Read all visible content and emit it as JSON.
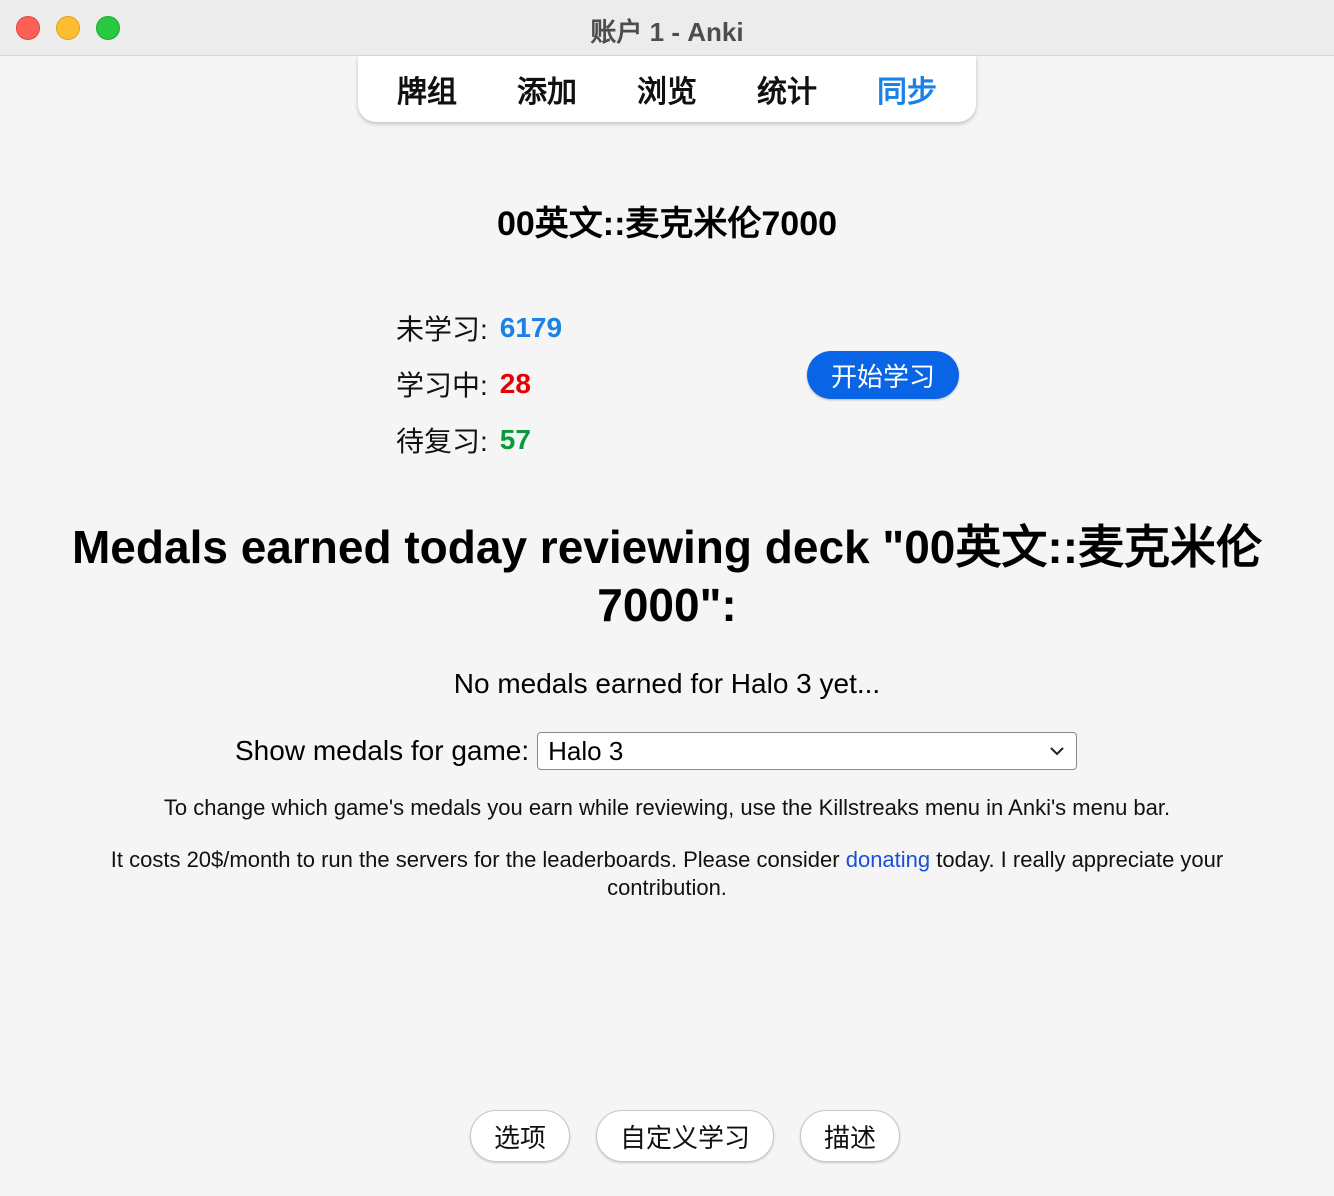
{
  "window": {
    "title": "账户 1 - Anki"
  },
  "toolbar": {
    "items": [
      {
        "label": "牌组",
        "active": false
      },
      {
        "label": "添加",
        "active": false
      },
      {
        "label": "浏览",
        "active": false
      },
      {
        "label": "统计",
        "active": false
      },
      {
        "label": "同步",
        "active": true
      }
    ],
    "active_color": "#1a82e6"
  },
  "deck": {
    "title": "00英文::麦克米伦7000",
    "stats": [
      {
        "label": "未学习:",
        "value": "6179",
        "color": "#1a82e6"
      },
      {
        "label": "学习中:",
        "value": "28",
        "color": "#e60000"
      },
      {
        "label": "待复习:",
        "value": "57",
        "color": "#0a9a3c"
      }
    ],
    "study_button": "开始学习"
  },
  "medals": {
    "heading": "Medals earned today reviewing deck \"00英文::麦克米伦7000\":",
    "empty_text": "No medals earned for Halo 3 yet...",
    "select_label": "Show medals for game:",
    "selected_game": "Halo 3",
    "info": "To change which game's medals you earn while reviewing, use the Killstreaks menu in Anki's menu bar.",
    "donate_prefix": "It costs 20$/month to run the servers for the leaderboards. Please consider ",
    "donate_link": "donating",
    "donate_suffix": " today. I really appreciate your contribution."
  },
  "footer": {
    "options": "选项",
    "custom_study": "自定义学习",
    "description": "描述"
  }
}
